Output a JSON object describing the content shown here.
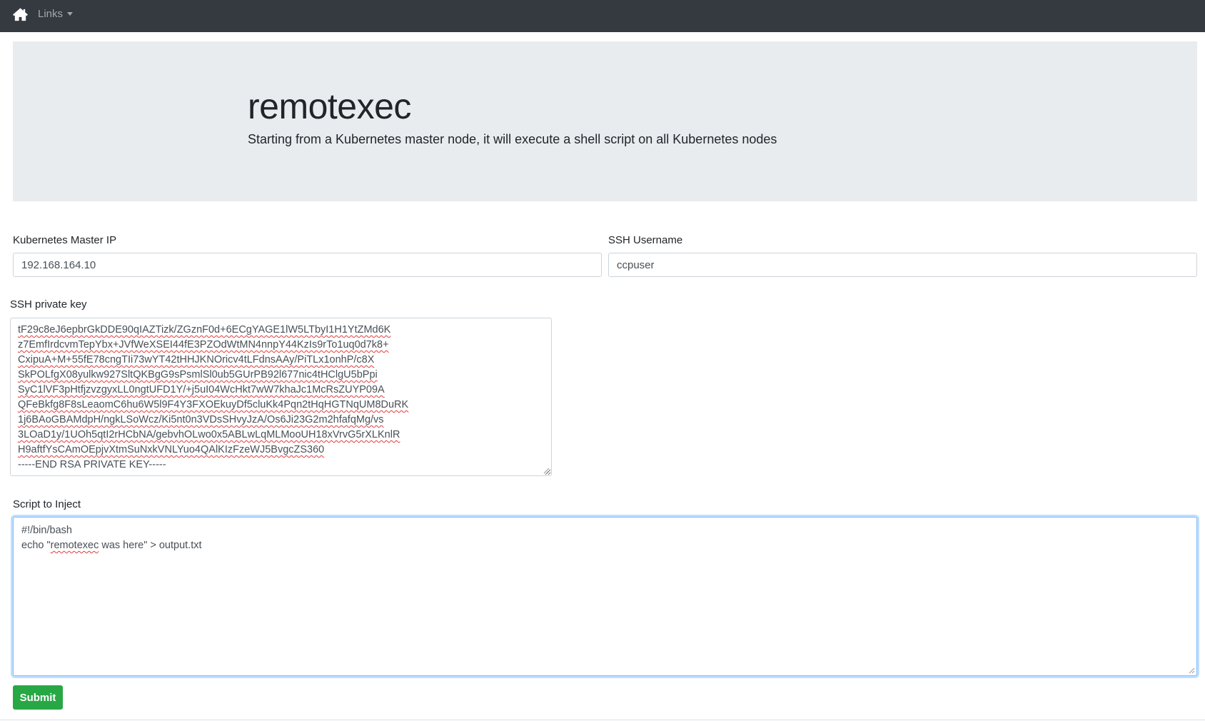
{
  "navbar": {
    "home_icon": "home-icon",
    "links_label": "Links",
    "caret_icon": "chevron-down-icon"
  },
  "jumbotron": {
    "title": "remotexec",
    "subtitle": "Starting from a Kubernetes master node, it will execute a shell script on all Kubernetes nodes"
  },
  "form": {
    "master_ip": {
      "label": "Kubernetes Master IP",
      "value": "192.168.164.10"
    },
    "ssh_username": {
      "label": "SSH Username",
      "value": "ccpuser"
    },
    "ssh_key": {
      "label": "SSH private key",
      "lines": [
        "tF29c8eJ6epbrGkDDE90qIAZTizk/ZGznF0d+6ECgYAGE1lW5LTbyI1H1YtZMd6K",
        "z7EmfIrdcvmTepYbx+JVfWeXSEI44fE3PZOdWtMN4nnpY44KzIs9rTo1uq0d7k8+",
        "CxipuA+M+55fE78cngTIi73wYT42tHHJKNOricv4tLFdnsAAy/PiTLx1onhP/c8X",
        "SkPOLfgX08yulkw927SltQKBgG9sPsmlSl0ub5GUrPB92l677nic4tHClgU5bPpi",
        "SyC1lVF3pHtfjzvzgyxLL0ngtUFD1Y/+j5uI04WcHkt7wW7khaJc1McRsZUYP09A",
        "QFeBkfg8F8sLeaomC6hu6W5l9F4Y3FXOEkuyDf5cluKk4Pqn2tHqHGTNqUM8DuRK",
        "1j6BAoGBAMdpH/ngkLSoWcz/Ki5nt0n3VDsSHvyJzA/Os6Ji23G2m2hfafqMg/vs",
        "3LOaD1y/1UOh5qtI2rHCbNA/gebvhOLwo0x5ABLwLqMLMooUH18xVrvG5rXLKnlR",
        "H9aftfYsCAmOEpjvXtmSuNxkVNLYuo4QAlKIzFzeWJ5BvgcZS360",
        "-----END RSA PRIVATE KEY-----"
      ]
    },
    "script": {
      "label": "Script to Inject",
      "line1": "#!/bin/bash",
      "line2_pre": "echo \"",
      "line2_word": "remotexec",
      "line2_post": " was here\" > output.txt"
    },
    "submit_label": "Submit"
  },
  "colors": {
    "navbar_bg": "#343a40",
    "jumbotron_bg": "#e9ecef",
    "submit_bg": "#28a745",
    "focus_border": "#80bdff"
  }
}
